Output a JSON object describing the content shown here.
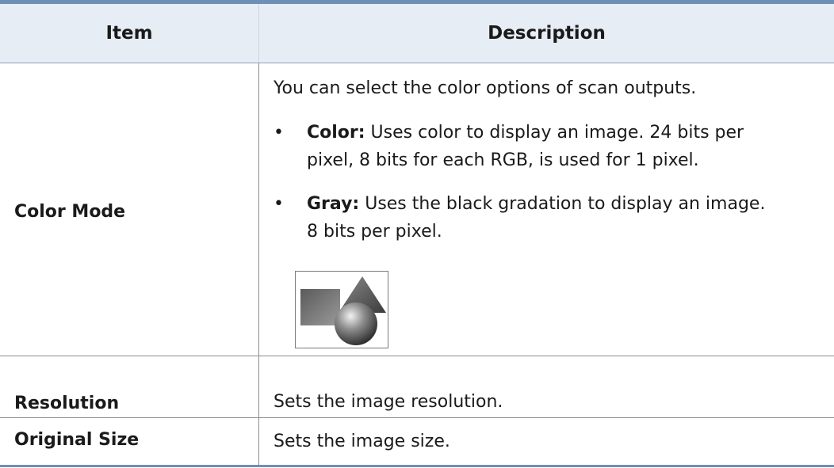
{
  "table": {
    "headers": {
      "item": "Item",
      "description": "Description"
    },
    "rows": [
      {
        "item": "Color Mode",
        "intro": "You can select the color options of scan outputs.",
        "bullets": [
          {
            "marker": "•",
            "term": "Color:",
            "line1": " Uses color to display an image. 24 bits per",
            "line2": "pixel, 8 bits for each RGB, is used for 1 pixel."
          },
          {
            "marker": "•",
            "term": "Gray:",
            "line1": " Uses the black gradation to display an image.",
            "line2": "8 bits per pixel."
          }
        ],
        "icon": "color-mode-shapes-icon"
      },
      {
        "item": "Resolution",
        "description": "Sets the image resolution."
      },
      {
        "item": "Original Size",
        "description": "Sets the image size."
      }
    ]
  },
  "colors": {
    "header_bg": "#e7edf5",
    "rule": "#6f8fb6"
  }
}
